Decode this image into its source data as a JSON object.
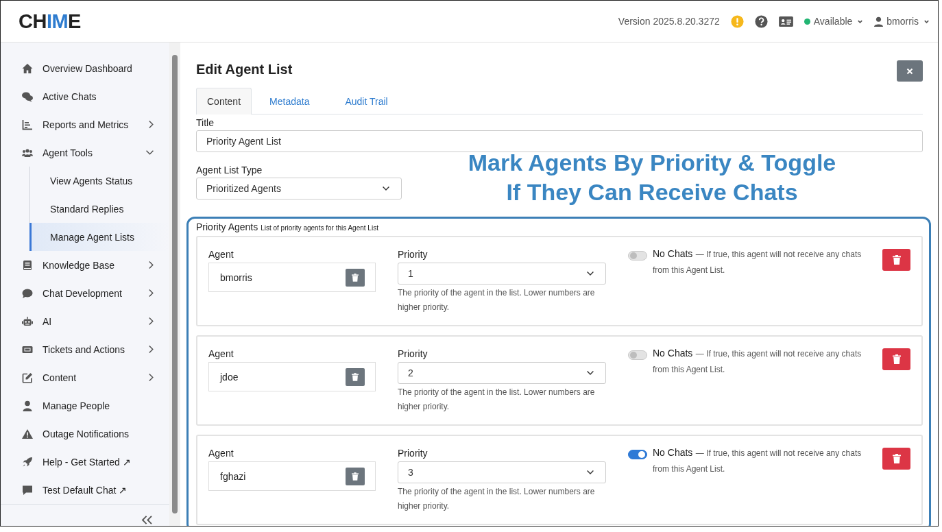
{
  "header": {
    "logo": [
      {
        "text": "CH",
        "accent": false
      },
      {
        "text": "IM",
        "accent": true
      },
      {
        "text": "E",
        "accent": false
      }
    ],
    "version": "Version 2025.8.20.3272",
    "status": "Available",
    "user": "bmorris"
  },
  "sidebar": {
    "items": [
      {
        "label": "Overview Dashboard",
        "expandable": false,
        "selected": false
      },
      {
        "label": "Active Chats",
        "expandable": false,
        "selected": false
      },
      {
        "label": "Reports and Metrics",
        "expandable": true,
        "expanded": false,
        "selected": false
      },
      {
        "label": "Agent Tools",
        "expandable": true,
        "selected": false,
        "expanded": true,
        "children": [
          {
            "label": "View Agents Status",
            "selected": false
          },
          {
            "label": "Standard Replies",
            "selected": false
          },
          {
            "label": "Manage Agent Lists",
            "selected": true
          }
        ]
      },
      {
        "label": "Knowledge Base",
        "expandable": true,
        "expanded": false,
        "selected": false
      },
      {
        "label": "Chat Development",
        "expandable": true,
        "expanded": false,
        "selected": false
      },
      {
        "label": "AI",
        "expandable": true,
        "expanded": false,
        "selected": false
      },
      {
        "label": "Tickets and Actions",
        "expandable": true,
        "expanded": false,
        "selected": false
      },
      {
        "label": "Content",
        "expandable": true,
        "expanded": false,
        "selected": false
      },
      {
        "label": "Manage People",
        "expandable": false,
        "selected": false
      },
      {
        "label": "Outage Notifications",
        "expandable": false,
        "selected": false
      },
      {
        "label": "Help - Get Started ↗",
        "expandable": false,
        "selected": false
      },
      {
        "label": "Test Default Chat ↗",
        "expandable": false,
        "selected": false
      }
    ]
  },
  "page": {
    "title": "Edit Agent List",
    "tabs": [
      {
        "label": "Content",
        "selected": true
      },
      {
        "label": "Metadata",
        "selected": false
      },
      {
        "label": "Audit Trail",
        "selected": false
      }
    ],
    "title_field": {
      "label": "Title",
      "value": "Priority Agent List"
    },
    "type_field": {
      "label": "Agent List Type",
      "value": "Prioritized Agents"
    },
    "priority_agents": {
      "label": "Priority Agents",
      "hint": "List of priority agents for this Agent List",
      "agents": [
        {
          "agent_label": "Agent",
          "agent": "bmorris",
          "priority_label": "Priority",
          "priority": "1",
          "priority_help": "The priority of the agent in the list. Lower numbers are higher priority.",
          "toggle_label": "No Chats",
          "toggle_help": "— If true, this agent will not receive any chats from this Agent List.",
          "on": false
        },
        {
          "agent_label": "Agent",
          "agent": "jdoe",
          "priority_label": "Priority",
          "priority": "2",
          "priority_help": "The priority of the agent in the list. Lower numbers are higher priority.",
          "toggle_label": "No Chats",
          "toggle_help": "— If true, this agent will not receive any chats from this Agent List.",
          "on": false
        },
        {
          "agent_label": "Agent",
          "agent": "fghazi",
          "priority_label": "Priority",
          "priority": "3",
          "priority_help": "The priority of the agent in the list. Lower numbers are higher priority.",
          "toggle_label": "No Chats",
          "toggle_help": "— If true, this agent will not receive any chats from this Agent List.",
          "on": true
        }
      ]
    }
  },
  "annotation": {
    "lines": [
      "Mark Agents By Priority & Toggle",
      "If They Can Receive Chats"
    ]
  }
}
